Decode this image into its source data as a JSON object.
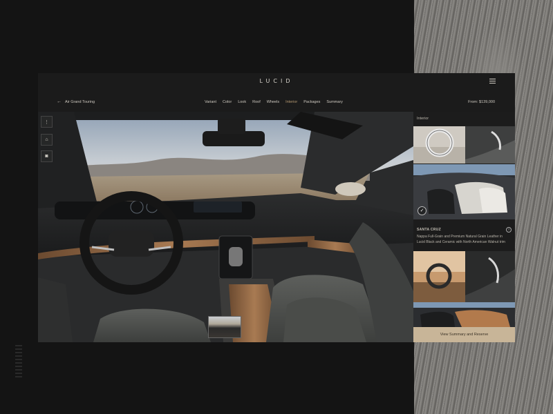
{
  "brand": {
    "logo_text": "LUCID"
  },
  "header": {
    "back_label": "Air Grand Touring",
    "back_icon": "arrow-left-icon",
    "menu_icon": "hamburger-menu-icon",
    "price": "From: $139,000"
  },
  "nav": {
    "items": [
      {
        "label": "Variant"
      },
      {
        "label": "Color"
      },
      {
        "label": "Look"
      },
      {
        "label": "Roof"
      },
      {
        "label": "Wheels"
      },
      {
        "label": "Interior",
        "active": true
      },
      {
        "label": "Packages"
      },
      {
        "label": "Summary"
      }
    ],
    "active_color": "#b69a72"
  },
  "viewer": {
    "tools": [
      {
        "icon": "more-vertical-icon",
        "glyph": "⋮"
      },
      {
        "icon": "car-exterior-icon",
        "glyph": "⌂"
      },
      {
        "icon": "camera-icon",
        "glyph": "◙"
      }
    ]
  },
  "panel": {
    "title": "Interior",
    "selected_trim": {
      "name": "SANTA CRUZ",
      "description": "Nappa Full-Grain and Premium Natural Grain Leather in Lucid Black and Ceramic with North American Walnut trim",
      "check_glyph": "✓",
      "info_glyph": "i"
    },
    "cta_label": "View Summary and Reserve"
  },
  "colors": {
    "accent": "#b69a72",
    "cta_background": "#c8b598",
    "app_background": "#1b1b1b"
  }
}
